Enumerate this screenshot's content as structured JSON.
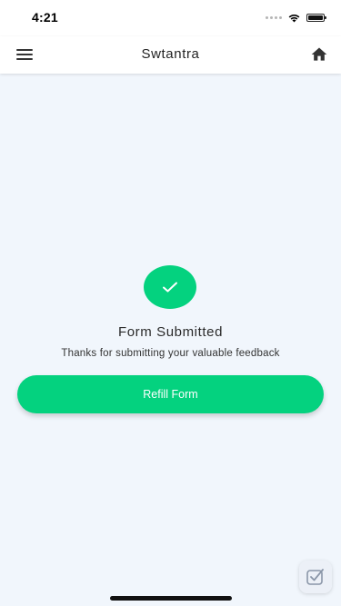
{
  "status_bar": {
    "time": "4:21"
  },
  "header": {
    "title": "Swtantra"
  },
  "main": {
    "title": "Form Submitted",
    "subtitle": "Thanks for submitting your valuable feedback",
    "refill_label": "Refill Form"
  },
  "icons": {
    "menu": "hamburger-menu-icon",
    "home": "home-icon",
    "success": "checkmark-icon",
    "badge": "checkmark-badge-icon"
  },
  "colors": {
    "accent": "#04d27f",
    "background": "#f1f6fc",
    "header_bg": "#ffffff"
  }
}
